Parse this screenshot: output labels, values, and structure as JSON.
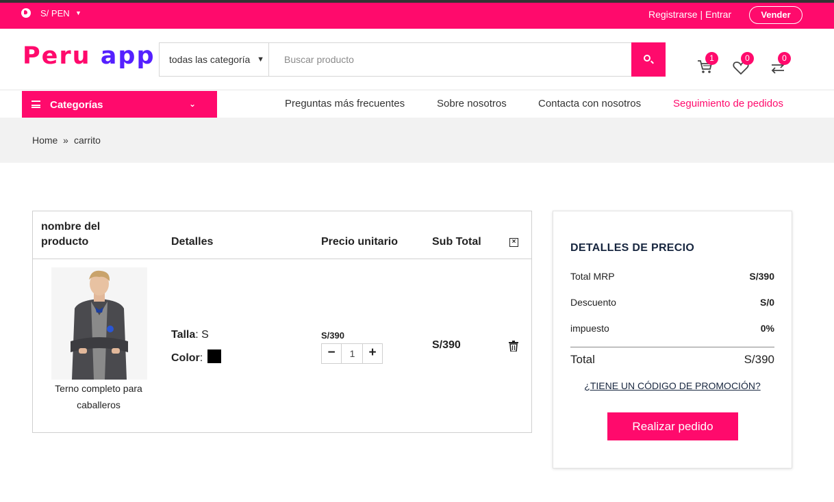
{
  "colors": {
    "accent": "#ff0a6c",
    "logo_secondary": "#5520ff"
  },
  "topbar": {
    "currency": "S/ PEN",
    "auth_text": "Registrarse | Entrar",
    "sell_button": "Vender"
  },
  "header": {
    "logo_part1": "Peru",
    "logo_part2": "app",
    "category_select": "todas las categoría",
    "search_placeholder": "Buscar producto",
    "cart_count": "1",
    "wishlist_count": "0",
    "compare_count": "0"
  },
  "nav": {
    "categories_label": "Categorías",
    "links": [
      "Preguntas más frecuentes",
      "Sobre nosotros",
      "Contacta con nosotros",
      "Seguimiento de pedidos"
    ]
  },
  "breadcrumb": {
    "home": "Home",
    "sep": "»",
    "current": "carrito"
  },
  "cart": {
    "headers": {
      "name_line1": "nombre del",
      "name_line2": "producto",
      "details": "Detalles",
      "unit_price": "Precio unitario",
      "subtotal": "Sub Total"
    },
    "item": {
      "name": "Terno completo para caballeros",
      "size_label": "Talla",
      "size_value": "S",
      "color_label": "Color",
      "color_value": "#000000",
      "unit_price": "S/390",
      "quantity": "1",
      "subtotal": "S/390"
    }
  },
  "summary": {
    "title": "DETALLES DE PRECIO",
    "rows": [
      {
        "label": "Total MRP",
        "value": "S/390"
      },
      {
        "label": "Descuento",
        "value": "S/0"
      },
      {
        "label": "impuesto",
        "value": "0%"
      }
    ],
    "total_label": "Total",
    "total_value": "S/390",
    "promo_link": "¿TIENE UN CÓDIGO DE PROMOCIÓN?",
    "order_button": "Realizar pedido"
  }
}
